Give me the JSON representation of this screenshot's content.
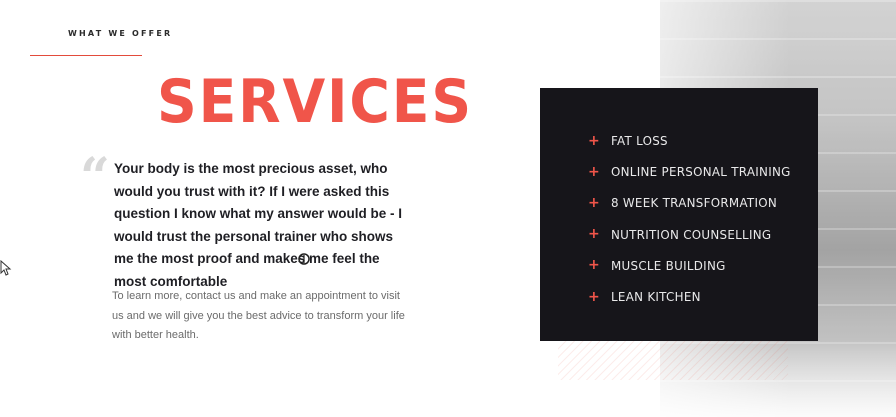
{
  "section": {
    "eyebrow": "WHAT WE OFFER",
    "title": "SERVICES",
    "quote_mark": "“",
    "quote": "Your body is the most precious asset, who would you trust with it? If I were asked this question I know what my answer would be - I would trust the personal trainer who shows me the most proof and makes me feel the most comfortable",
    "body": "To learn more, contact us and make an appointment to visit us and we will give you the best advice to transform your life with better health."
  },
  "services": {
    "icon": "plus-icon",
    "items": [
      {
        "label": "FAT LOSS"
      },
      {
        "label": "ONLINE PERSONAL TRAINING"
      },
      {
        "label": "8 WEEK TRANSFORMATION"
      },
      {
        "label": "NUTRITION COUNSELLING"
      },
      {
        "label": "MUSCLE BUILDING"
      },
      {
        "label": "LEAN KITCHEN"
      }
    ]
  },
  "colors": {
    "accent": "#f0554a",
    "card_bg": "#16151a",
    "text_dark": "#1f1f24",
    "text_muted": "#6b6b6b"
  }
}
